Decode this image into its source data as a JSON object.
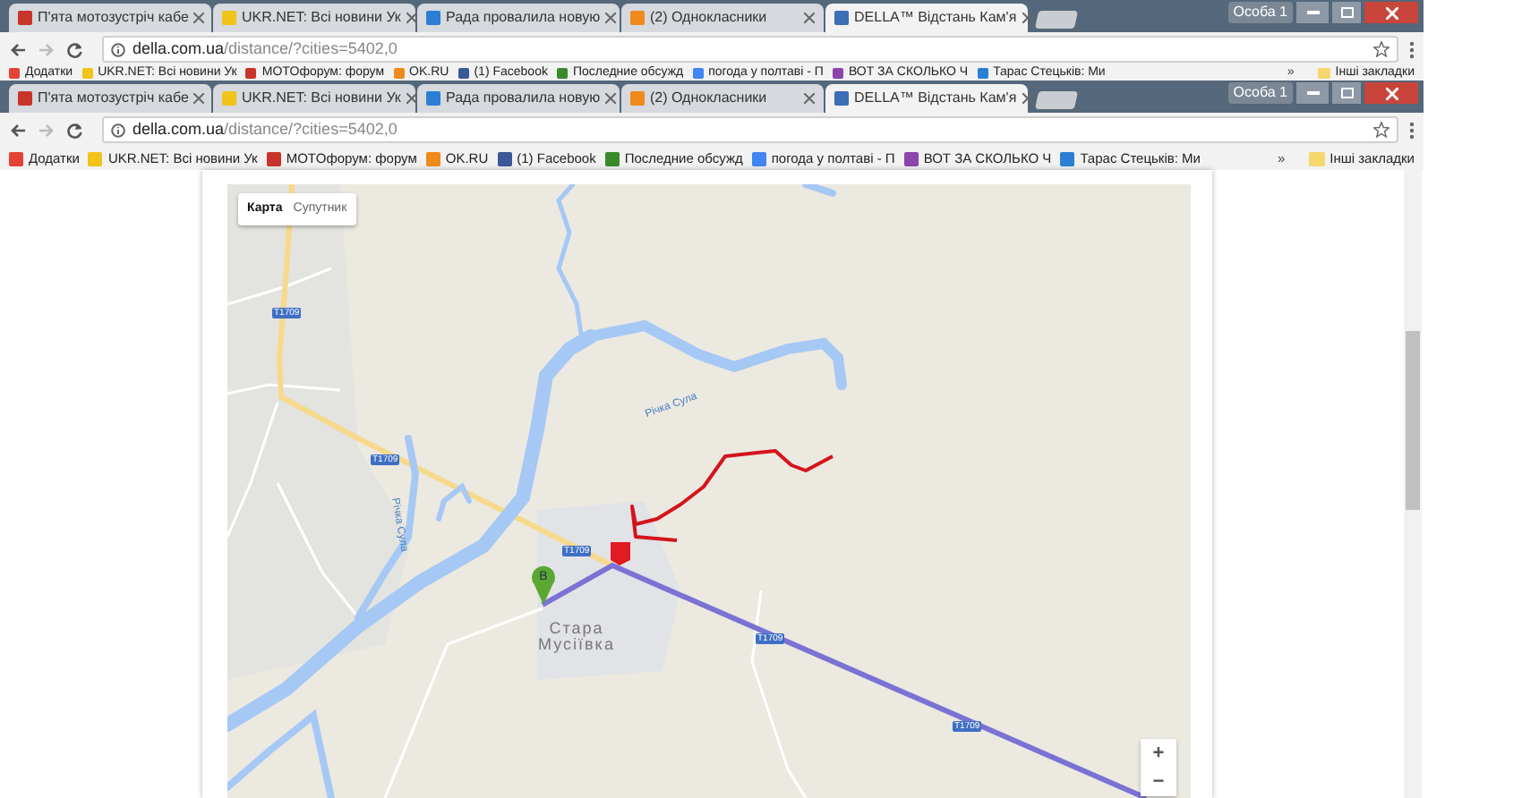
{
  "windows": [
    {
      "tabs": [
        {
          "label": "П'ята мотозустріч кабе",
          "selected": false
        },
        {
          "label": "UKR.NET: Всі новини Ук",
          "selected": false
        },
        {
          "label": "Рада провалила новую",
          "selected": false
        },
        {
          "label": "(2) Однокласники",
          "selected": false
        },
        {
          "label": "DELLA™ Відстань Кам'я",
          "selected": true
        }
      ],
      "profile": "Особа 1",
      "url_domain": "della.com.ua",
      "url_path": "/distance/?cities=5402,0",
      "bookmarks": [
        "Додатки",
        "UKR.NET: Всі новини Ук",
        "MOTOфорум: форум",
        "OK.RU",
        "(1) Facebook",
        "Последние обсужд",
        "погода у полтаві - П",
        "ВОТ ЗА СКОЛЬКО Ч",
        "Тарас Стецьків: Ми"
      ],
      "more_bookmarks": "»",
      "other_bookmarks": "Інші закладки"
    },
    {
      "tabs": [
        {
          "label": "П'ята мотозустріч кабе",
          "selected": false
        },
        {
          "label": "UKR.NET: Всі новини Ук",
          "selected": false
        },
        {
          "label": "Рада провалила новую",
          "selected": false
        },
        {
          "label": "(2) Однокласники",
          "selected": false
        },
        {
          "label": "DELLA™ Відстань Кам'я",
          "selected": true
        }
      ],
      "profile": "Особа 1",
      "url_domain": "della.com.ua",
      "url_path": "/distance/?cities=5402,0",
      "bookmarks": [
        "Додатки",
        "UKR.NET: Всі новини Ук",
        "MOTOфорум: форум",
        "OK.RU",
        "(1) Facebook",
        "Последние обсужд",
        "погода у полтаві - П",
        "ВОТ ЗА СКОЛЬКО Ч",
        "Тарас Стецьків: Ми"
      ],
      "more_bookmarks": "»",
      "other_bookmarks": "Інші закладки"
    }
  ],
  "map": {
    "view_tabs": [
      {
        "label": "Карта",
        "selected": true
      },
      {
        "label": "Супутник",
        "selected": false
      }
    ],
    "road_labels": [
      "T1709",
      "T1709",
      "T1709",
      "T1709",
      "T1709"
    ],
    "river_labels": [
      "Річка Сула",
      "Річка Сула"
    ],
    "place_label": "Стара Мусіївка",
    "marker_label": "B",
    "zoom_buttons": [
      "+",
      "−"
    ]
  }
}
